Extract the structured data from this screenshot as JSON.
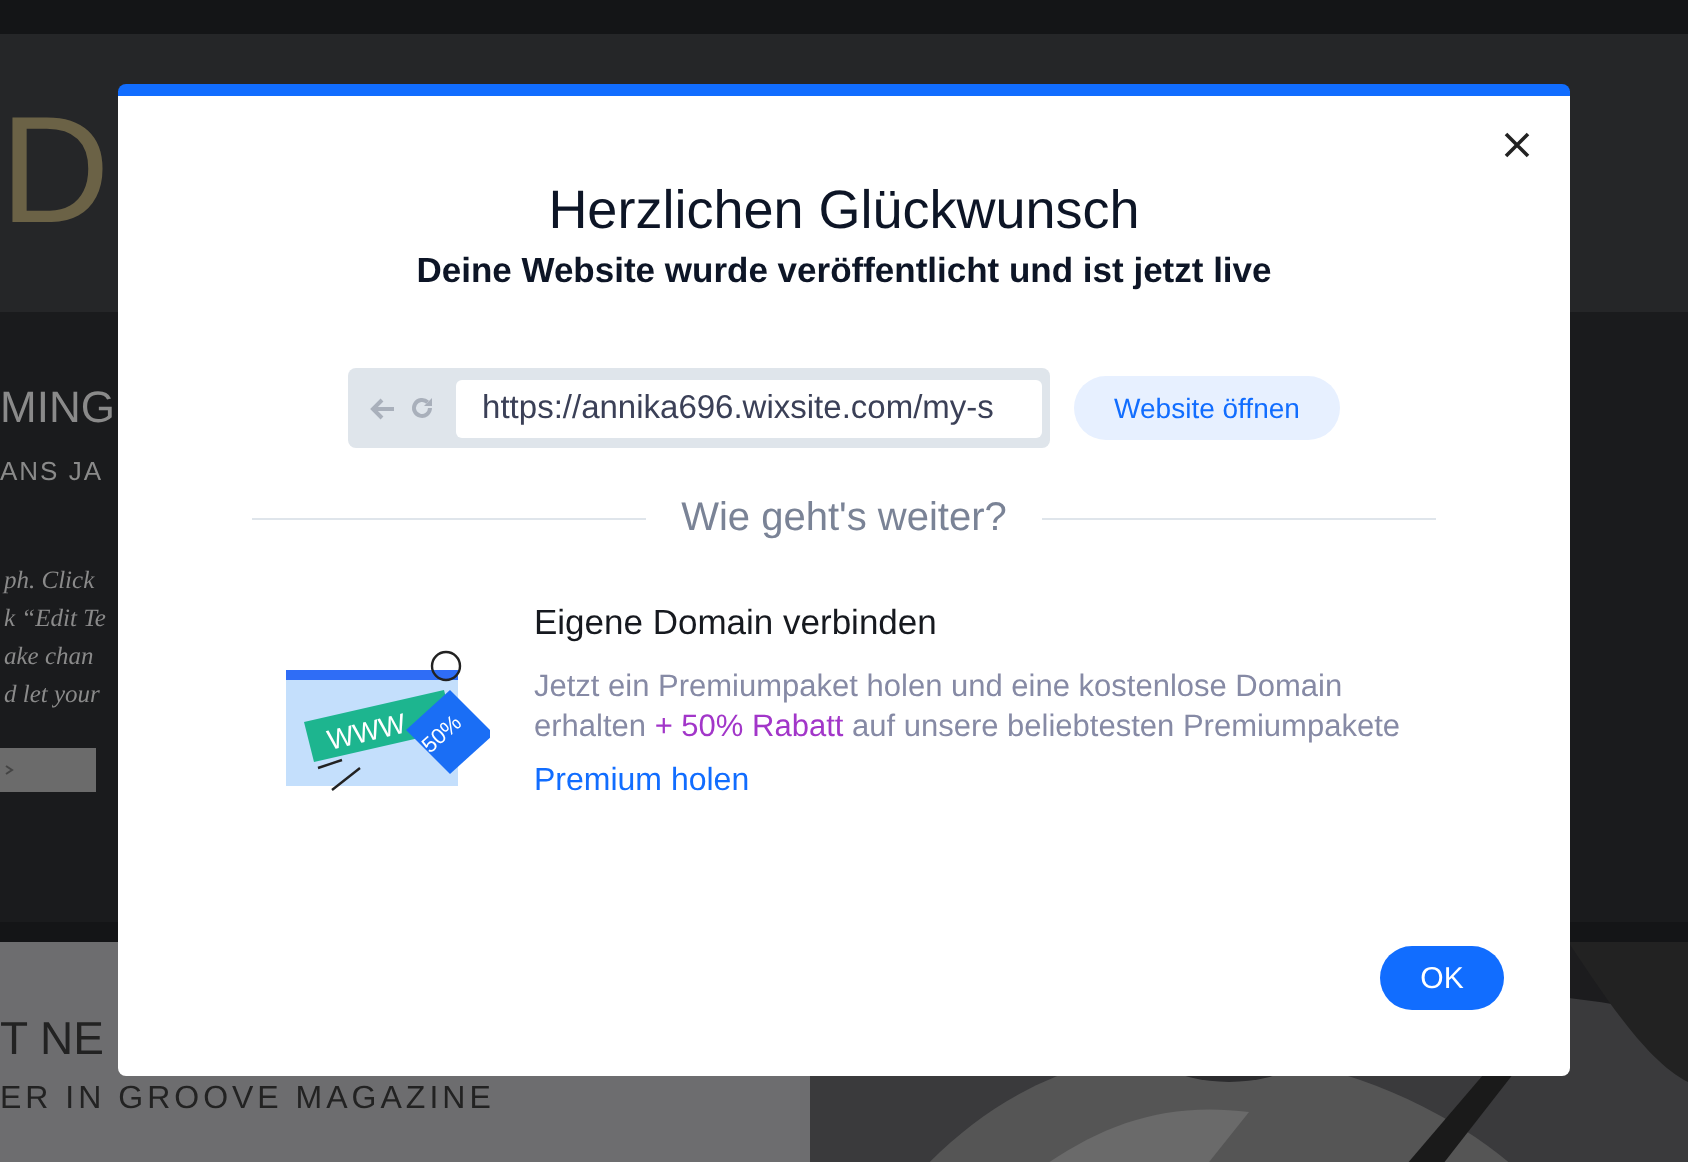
{
  "background": {
    "logo": "D",
    "heading": "MING",
    "subheading": "ANS JA",
    "paragraph": [
      "ph. Click",
      "k “Edit Te",
      "ake chan",
      "d let your"
    ],
    "news_heading": "T NE",
    "news_subheading": "ER IN GROOVE MAGAZINE"
  },
  "dialog": {
    "title": "Herzlichen Glückwunsch",
    "subtitle": "Deine Website wurde veröffentlicht und ist jetzt live",
    "url": "https://annika696.wixsite.com/my-s",
    "open_button": "Website öffnen",
    "section_title": "Wie geht's weiter?",
    "offer": {
      "tag_text": "WWW",
      "badge_text": "50%",
      "title": "Eigene Domain verbinden",
      "text_before": "Jetzt ein Premiumpaket holen und eine kostenlose Domain erhalten ",
      "highlight": "+ 50% Rabatt",
      "text_after": " auf unsere beliebtesten Premiumpakete",
      "link": "Premium holen"
    },
    "ok_button": "OK"
  }
}
